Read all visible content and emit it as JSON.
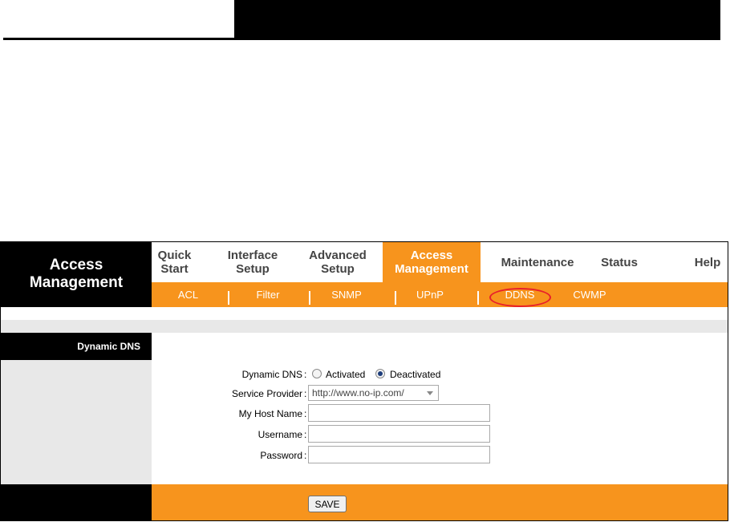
{
  "brand": {
    "line1": "Access",
    "line2": "Management"
  },
  "menu": [
    {
      "line1": "Quick",
      "line2": "Start",
      "active": false
    },
    {
      "line1": "Interface",
      "line2": "Setup",
      "active": false
    },
    {
      "line1": "Advanced",
      "line2": "Setup",
      "active": false
    },
    {
      "line1": "Access",
      "line2": "Management",
      "active": true
    },
    {
      "line1": "Maintenance",
      "line2": "",
      "active": false
    },
    {
      "line1": "Status",
      "line2": "",
      "active": false
    },
    {
      "line1": "Help",
      "line2": "",
      "active": false
    }
  ],
  "submenu": [
    "ACL",
    "Filter",
    "SNMP",
    "UPnP",
    "DDNS",
    "CWMP"
  ],
  "section": {
    "label": "Dynamic DNS"
  },
  "form": {
    "dynamic_dns_label": "Dynamic DNS",
    "activated_label": "Activated",
    "deactivated_label": "Deactivated",
    "selected": "Deactivated",
    "service_provider_label": "Service Provider",
    "service_provider_value": "http://www.no-ip.com/",
    "host_name_label": "My Host Name",
    "host_name_value": "",
    "username_label": "Username",
    "username_value": "",
    "password_label": "Password",
    "password_value": ""
  },
  "save_label": "SAVE",
  "colors": {
    "accent": "#f7941d",
    "highlight_circle": "#e8202a"
  }
}
